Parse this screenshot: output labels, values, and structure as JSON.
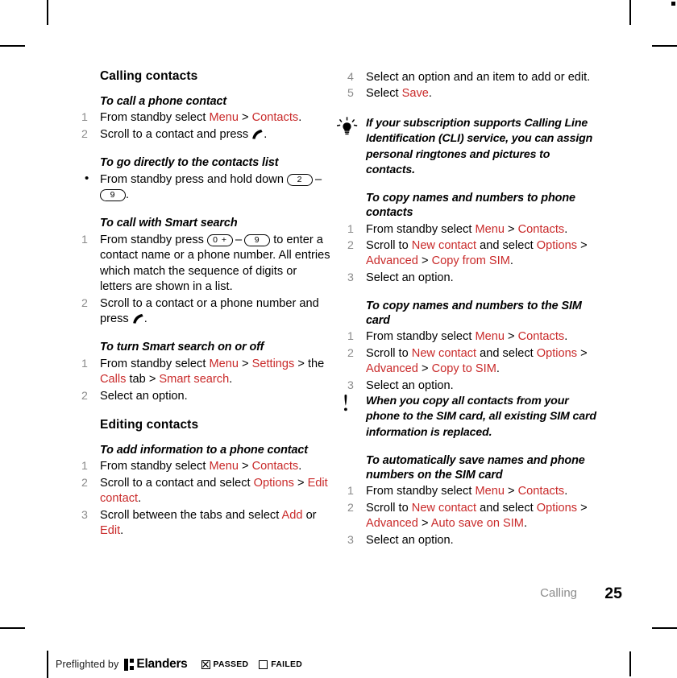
{
  "document": {
    "chapter_footer": "Calling",
    "page_number": "25",
    "preflight": {
      "prefix": "Preflighted by",
      "brand": "Elanders",
      "passed_label": "PASSED",
      "failed_label": "FAILED",
      "passed_checked": true,
      "failed_checked": false
    },
    "accent_color": "#c92a2a",
    "number_color": "#8b8b8b"
  },
  "left_column": {
    "section_title": "Calling contacts",
    "blocks": [
      {
        "heading": "To call a phone contact",
        "list_type": "ordered",
        "steps": [
          {
            "num": "1",
            "parts": [
              {
                "t": "From standby select ",
                "c": "k"
              },
              {
                "t": "Menu",
                "c": "r"
              },
              {
                "t": " > ",
                "c": "k"
              },
              {
                "t": "Contacts",
                "c": "r"
              },
              {
                "t": ".",
                "c": "k"
              }
            ]
          },
          {
            "num": "2",
            "parts": [
              {
                "t": "Scroll to a contact and press ",
                "c": "k"
              },
              {
                "t": "",
                "c": "call"
              },
              {
                "t": ".",
                "c": "k"
              }
            ]
          }
        ]
      },
      {
        "heading": "To go directly to the contacts list",
        "list_type": "bullet",
        "steps": [
          {
            "num": "•",
            "parts": [
              {
                "t": "From standby press and hold down ",
                "c": "k"
              },
              {
                "t": "2",
                "c": "key"
              },
              {
                "t": "–",
                "c": "dash"
              },
              {
                "t": "9",
                "c": "key"
              },
              {
                "t": ".",
                "c": "k"
              }
            ]
          }
        ]
      },
      {
        "heading": "To call with Smart search",
        "list_type": "ordered",
        "steps": [
          {
            "num": "1",
            "parts": [
              {
                "t": "From standby press ",
                "c": "k"
              },
              {
                "t": "0 +",
                "c": "key"
              },
              {
                "t": "–",
                "c": "dash"
              },
              {
                "t": "9",
                "c": "key"
              },
              {
                "t": " to enter a contact name or a phone number. All entries which match the sequence of digits or letters are shown in a list.",
                "c": "k"
              }
            ]
          },
          {
            "num": "2",
            "parts": [
              {
                "t": "Scroll to a contact or a phone number and press ",
                "c": "k"
              },
              {
                "t": "",
                "c": "call"
              },
              {
                "t": ".",
                "c": "k"
              }
            ]
          }
        ]
      },
      {
        "heading": "To turn Smart search on or off",
        "list_type": "ordered",
        "steps": [
          {
            "num": "1",
            "parts": [
              {
                "t": "From standby select ",
                "c": "k"
              },
              {
                "t": "Menu",
                "c": "r"
              },
              {
                "t": " > ",
                "c": "k"
              },
              {
                "t": "Settings",
                "c": "r"
              },
              {
                "t": " > the ",
                "c": "k"
              },
              {
                "t": "Calls",
                "c": "r"
              },
              {
                "t": " tab > ",
                "c": "k"
              },
              {
                "t": "Smart search",
                "c": "r"
              },
              {
                "t": ".",
                "c": "k"
              }
            ]
          },
          {
            "num": "2",
            "parts": [
              {
                "t": "Select an option.",
                "c": "k"
              }
            ]
          }
        ]
      }
    ],
    "section_title_2": "Editing contacts",
    "blocks_2": [
      {
        "heading": "To add information to a phone contact",
        "list_type": "ordered",
        "steps": [
          {
            "num": "1",
            "parts": [
              {
                "t": "From standby select ",
                "c": "k"
              },
              {
                "t": "Menu",
                "c": "r"
              },
              {
                "t": " > ",
                "c": "k"
              },
              {
                "t": "Contacts",
                "c": "r"
              },
              {
                "t": ".",
                "c": "k"
              }
            ]
          },
          {
            "num": "2",
            "parts": [
              {
                "t": "Scroll to a contact and select ",
                "c": "k"
              },
              {
                "t": "Options",
                "c": "r"
              },
              {
                "t": " > ",
                "c": "k"
              },
              {
                "t": "Edit contact",
                "c": "r"
              },
              {
                "t": ".",
                "c": "k"
              }
            ]
          },
          {
            "num": "3",
            "parts": [
              {
                "t": "Scroll between the tabs and select ",
                "c": "k"
              },
              {
                "t": "Add",
                "c": "r"
              },
              {
                "t": " or ",
                "c": "k"
              },
              {
                "t": "Edit",
                "c": "r"
              },
              {
                "t": ".",
                "c": "k"
              }
            ]
          }
        ]
      }
    ]
  },
  "right_column": {
    "continued_steps": [
      {
        "num": "4",
        "parts": [
          {
            "t": "Select an option and an item to add or edit.",
            "c": "k"
          }
        ]
      },
      {
        "num": "5",
        "parts": [
          {
            "t": "Select ",
            "c": "k"
          },
          {
            "t": "Save",
            "c": "r"
          },
          {
            "t": ".",
            "c": "k"
          }
        ]
      }
    ],
    "tip_note": {
      "icon": "lightbulb-icon",
      "text": "If your subscription supports Calling Line Identification (CLI) service, you can assign personal ringtones and pictures to contacts."
    },
    "blocks": [
      {
        "heading": "To copy names and numbers to phone contacts",
        "list_type": "ordered",
        "steps": [
          {
            "num": "1",
            "parts": [
              {
                "t": "From standby select ",
                "c": "k"
              },
              {
                "t": "Menu",
                "c": "r"
              },
              {
                "t": " > ",
                "c": "k"
              },
              {
                "t": "Contacts",
                "c": "r"
              },
              {
                "t": ".",
                "c": "k"
              }
            ]
          },
          {
            "num": "2",
            "parts": [
              {
                "t": "Scroll to ",
                "c": "k"
              },
              {
                "t": "New contact",
                "c": "r"
              },
              {
                "t": " and select ",
                "c": "k"
              },
              {
                "t": "Options",
                "c": "r"
              },
              {
                "t": " > ",
                "c": "k"
              },
              {
                "t": "Advanced",
                "c": "r"
              },
              {
                "t": " > ",
                "c": "k"
              },
              {
                "t": "Copy from SIM",
                "c": "r"
              },
              {
                "t": ".",
                "c": "k"
              }
            ]
          },
          {
            "num": "3",
            "parts": [
              {
                "t": "Select an option.",
                "c": "k"
              }
            ]
          }
        ]
      },
      {
        "heading": "To copy names and numbers to the SIM card",
        "list_type": "ordered",
        "steps": [
          {
            "num": "1",
            "parts": [
              {
                "t": "From standby select ",
                "c": "k"
              },
              {
                "t": "Menu",
                "c": "r"
              },
              {
                "t": " > ",
                "c": "k"
              },
              {
                "t": "Contacts",
                "c": "r"
              },
              {
                "t": ".",
                "c": "k"
              }
            ]
          },
          {
            "num": "2",
            "parts": [
              {
                "t": "Scroll to ",
                "c": "k"
              },
              {
                "t": "New contact",
                "c": "r"
              },
              {
                "t": " and select ",
                "c": "k"
              },
              {
                "t": "Options",
                "c": "r"
              },
              {
                "t": " > ",
                "c": "k"
              },
              {
                "t": "Advanced",
                "c": "r"
              },
              {
                "t": " > ",
                "c": "k"
              },
              {
                "t": "Copy to SIM",
                "c": "r"
              },
              {
                "t": ".",
                "c": "k"
              }
            ]
          },
          {
            "num": "3",
            "parts": [
              {
                "t": "Select an option.",
                "c": "k"
              }
            ]
          }
        ]
      }
    ],
    "warning_note": {
      "icon": "exclamation-icon",
      "text": "When you copy all contacts from your phone to the SIM card, all existing SIM card information is replaced."
    },
    "blocks_2": [
      {
        "heading": "To automatically save names and phone numbers on the SIM card",
        "list_type": "ordered",
        "steps": [
          {
            "num": "1",
            "parts": [
              {
                "t": "From standby select ",
                "c": "k"
              },
              {
                "t": "Menu",
                "c": "r"
              },
              {
                "t": " > ",
                "c": "k"
              },
              {
                "t": "Contacts",
                "c": "r"
              },
              {
                "t": ".",
                "c": "k"
              }
            ]
          },
          {
            "num": "2",
            "parts": [
              {
                "t": "Scroll to ",
                "c": "k"
              },
              {
                "t": "New contact",
                "c": "r"
              },
              {
                "t": " and select ",
                "c": "k"
              },
              {
                "t": "Options",
                "c": "r"
              },
              {
                "t": " > ",
                "c": "k"
              },
              {
                "t": "Advanced",
                "c": "r"
              },
              {
                "t": " > ",
                "c": "k"
              },
              {
                "t": "Auto save on SIM",
                "c": "r"
              },
              {
                "t": ".",
                "c": "k"
              }
            ]
          },
          {
            "num": "3",
            "parts": [
              {
                "t": "Select an option.",
                "c": "k"
              }
            ]
          }
        ]
      }
    ]
  }
}
